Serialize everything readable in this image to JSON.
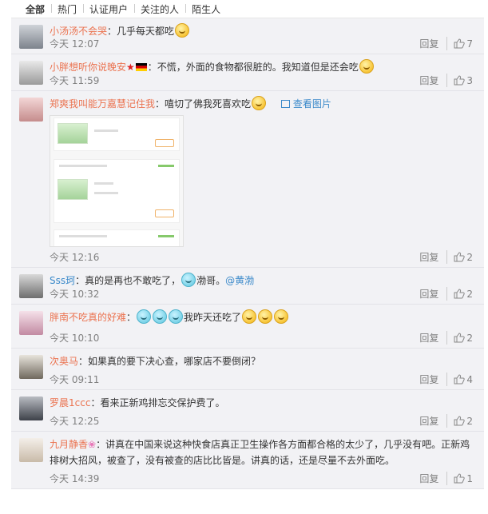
{
  "tabs": [
    "全部",
    "热门",
    "认证用户",
    "关注的人",
    "陌生人"
  ],
  "reply_label": "回复",
  "comments": [
    {
      "user": "小汤汤不会哭",
      "sep": "：",
      "text": "几乎每天都吃",
      "time": "今天 12:07",
      "likes": "7"
    },
    {
      "user": "小胖想听你说晚安",
      "sep": "：",
      "text": "不慌，外面的食物都很脏的。我知道但是还会吃",
      "time": "今天 11:59",
      "likes": "3"
    },
    {
      "user": "郑爽我叫能万嘉慧记住我",
      "sep": "：",
      "text": "嘻切了佛我死喜欢吃",
      "pic_link": "查看图片",
      "time": "今天 12:16",
      "likes": "2"
    },
    {
      "user": "Sss珂",
      "sep": "：",
      "text": "真的是再也不敢吃了，",
      "text2": "渤哥。",
      "at": "@黄渤",
      "time": "今天 10:32",
      "likes": "2"
    },
    {
      "user": "胖南不吃真的好难",
      "sep": "：",
      "text": "我昨天还吃了",
      "time": "今天 10:10",
      "likes": "2"
    },
    {
      "user": "次奥马",
      "sep": "：",
      "text": "如果真的要下决心查，哪家店不要倒闭？",
      "time": "今天 09:11",
      "likes": "4"
    },
    {
      "user": "罗晨1ccc",
      "sep": "：",
      "text": "看来正新鸡排忘交保护费了。",
      "time": "今天 12:25",
      "likes": "2"
    },
    {
      "user": "九月静香",
      "sep": "：",
      "text": "讲真在中国来说这种快食店真正卫生操作各方面都合格的太少了，几乎没有吧。正新鸡排树大招风，被查了，没有被查的店比比皆是。讲真的话，还是尽量不去外面吃。",
      "time": "今天 14:39",
      "likes": "1"
    }
  ],
  "colors": {
    "username": "#eb7350",
    "link": "#3c8aca",
    "background": "#f2f2f5"
  }
}
